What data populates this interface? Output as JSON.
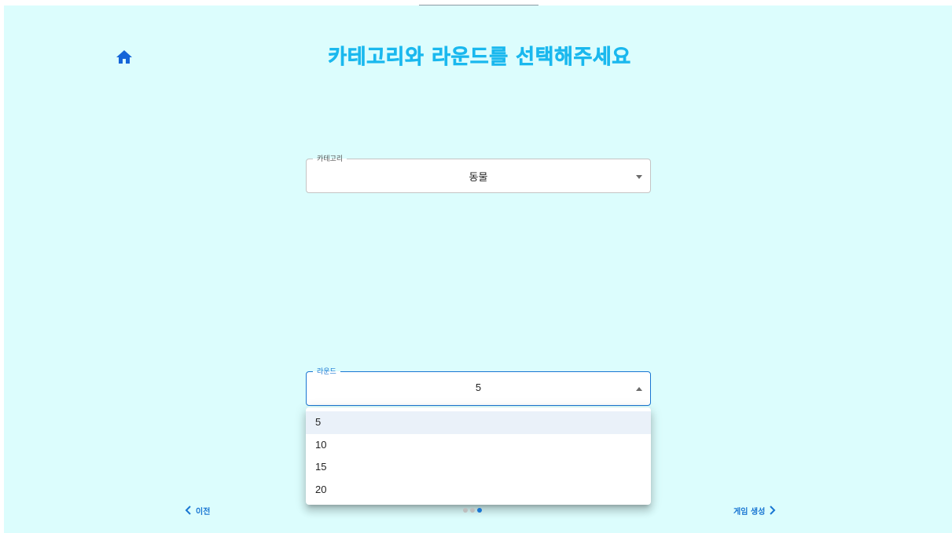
{
  "page": {
    "title": "카테고리와 라운드를 선택해주세요"
  },
  "category_select": {
    "label": "카테고리",
    "value": "동물"
  },
  "round_select": {
    "label": "라운드",
    "value": "5",
    "options": [
      "5",
      "10",
      "15",
      "20"
    ],
    "selected_index": 0
  },
  "stepper": {
    "prev_label": "이전",
    "next_label": "게임 생성",
    "steps": 3,
    "active_step": 3
  },
  "colors": {
    "background": "#dcfdfd",
    "title": "#1ab8ee",
    "accent": "#1976d2"
  },
  "icons": {
    "home": "home-icon",
    "prev": "chevron-left-icon",
    "next": "chevron-right-icon",
    "dropdown_closed": "arrow-drop-down-icon",
    "dropdown_open": "arrow-drop-up-icon"
  }
}
